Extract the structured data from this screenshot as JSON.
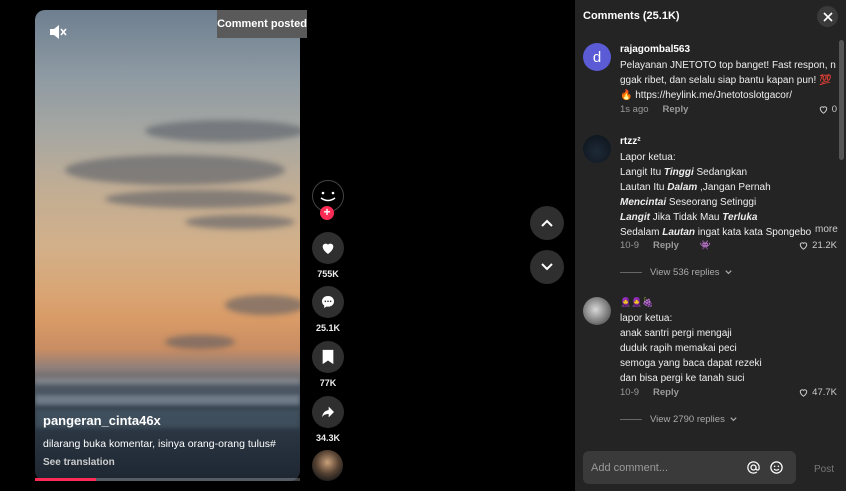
{
  "video": {
    "toast": "Comment posted",
    "author": "pangeran_cinta46x",
    "description": "dilarang buka komentar, isinya orang-orang tulus#",
    "see_translation": "See translation",
    "progress": 0.23
  },
  "actions": {
    "likes": "755K",
    "comments": "25.1K",
    "saves": "77K",
    "shares": "34.3K"
  },
  "panel": {
    "title": "Comments (25.1K)",
    "input_placeholder": "Add comment...",
    "post_label": "Post",
    "more_label": "more"
  },
  "comments": [
    {
      "user": "rajagombal563",
      "avatar_letter": "d",
      "lines": [
        "Pelayanan JNETOTO top banget! Fast respon, n",
        "ggak ribet, dan selalu siap bantu kapan pun! 💯",
        "🔥 https://heylink.me/Jnetotoslotgacor/"
      ],
      "time": "1s ago",
      "reply": "Reply",
      "likes": "0"
    },
    {
      "user": "rtzz²",
      "lines_header": "Lapor ketua:",
      "rich_lines": [
        [
          "Langit Itu ",
          "Tinggi",
          " Sedangkan"
        ],
        [
          "Lautan Itu ",
          "Dalam",
          " ,Jangan Pernah"
        ],
        [
          "",
          "Mencintai",
          " Seseorang Setinggi"
        ],
        [
          "",
          "Langit",
          " Jika Tidak Mau ",
          "Terluka"
        ],
        [
          "Sedalam ",
          "Lautan",
          " ingat kata kata Spongebo"
        ]
      ],
      "time": "10-9",
      "reply": "Reply",
      "likes": "21.2K",
      "view_replies": "View 536 replies"
    },
    {
      "user": "🧕🧕🍇",
      "lines": [
        "lapor ketua:",
        "anak santri pergi mengaji",
        "duduk rapih memakai peci",
        "semoga yang baca dapat rezeki",
        "dan bisa pergi ke tanah suci"
      ],
      "time": "10-9",
      "reply": "Reply",
      "likes": "47.7K",
      "view_replies": "View 2790 replies"
    }
  ],
  "colors": {
    "accent": "#fe2c55",
    "panel": "#242424",
    "avatar1": "#5b5bd6"
  }
}
